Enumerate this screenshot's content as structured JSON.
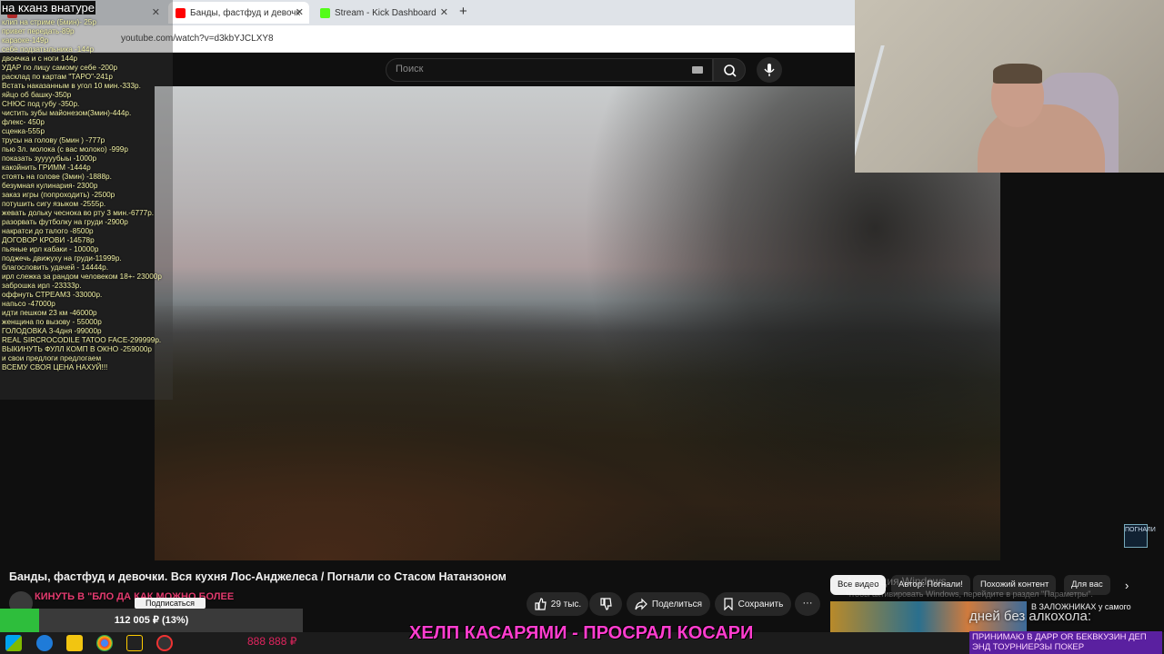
{
  "browser": {
    "tabs": [
      {
        "label": "",
        "favicon_color": "#e22"
      },
      {
        "label": "Банды, фастфуд и девочк",
        "favicon_color": "#ff0000"
      },
      {
        "label": "Stream - Kick Dashboard",
        "favicon_color": "#53fc18"
      }
    ],
    "add_tab_label": "+",
    "close_label": "✕",
    "url": "youtube.com/watch?v=d3kbYJCLXY8"
  },
  "youtube": {
    "search_placeholder": "Поиск",
    "video_title": "Банды, фастфуд и девочки. Вся кухня Лос-Анджелеса / Погнали со Стасом Натанзоном",
    "subscribe_label": "Подписаться",
    "likes_label": "29 тыс.",
    "share_label": "Поделиться",
    "save_label": "Сохранить",
    "more_label": "···",
    "watermark": "ПОГНАЛИ",
    "chips": [
      "Все видео",
      "Автор: Погнали!",
      "Похожий контент",
      "Для вас"
    ],
    "rec_title": "В ЗАЛОЖНИКАХ у самого"
  },
  "overlay": {
    "title": "на кханз внатуре",
    "subscribe_overlay": "КИНУТЬ В \"БЛО ДА КАК МОЖНО БОЛЕЕ",
    "price_list": [
      "клип на стриме (5мин)- 25р",
      "привет передать-89р",
      "караоке-149р",
      "себе подзатыльника -144р",
      "двоечка и с ноги 144р",
      "УДАР по лицу самому себе -200р",
      "расклад по картам \"ТАРО\"-241р",
      "Встать наказанным в угол 10 мин.-333р.",
      "яйцо об башку-350р",
      "СНЮС под губу -350р.",
      "чистить зубы майонезом(3мин)-444р.",
      "флекс- 450р",
      "сценка-555р",
      "трусы на голову (5мин ) -777р",
      "пью 3л. молока (с вас молоко) -999р",
      "показать зууууубыы -1000р",
      "какойнить ГРИММ -1444р",
      "стоять на голове (3мин) -1888р.",
      "безумная кулинария- 2300р",
      "заказ игры (попроходить) -2500р",
      "потушить сигу языком -2555р.",
      "жевать дольку чеснока во рту 3 мин.-6777р.",
      "разорвать футболку на груди -2900р",
      "накратси до талого -8500р",
      "ДОГОВОР КРОВИ -14578р",
      "пьяные ирл кабаки - 10000р",
      "поджечь движуху на груди-11999р.",
      "благословить удачей - 14444р.",
      "ирл слежка за рандом человеком 18+- 23000р",
      "заброшка ирл -23333р.",
      "оффнуть СТРЕАМЗ -33000р.",
      "напьсо -47000р",
      "идти пешком 23 км -46000р",
      "женщина по вызову - 55000р",
      "ГОЛОДОВКА 3-4дня -99000р",
      "REAL SIRCROCODILE TATOO FACE-299999р.",
      "ВЫКИНУТЬ ФУЛЛ КОМП В ОКНО -259000р",
      "и свои предлоги предлогаем",
      "ВСЕМУ СВОЯ ЦЕНА НАХУЙ!!!"
    ],
    "goal_text": "112 005 ₽ (13%)",
    "goal_fraction": 0.13,
    "banner": "ХЕЛП КАСАРЯМИ - ПРОСРАЛ КОСАРИ",
    "banner_right": "ПРИНИМАЮ В ДАРР OR БЕКВКУЗИН ДЕП ЭНД ТОУРНИЕРЗЫ ПОКЕР",
    "right_overlay_text": "дней без алкохола:",
    "taskbar_counter": "888 888 ₽"
  },
  "system": {
    "activation_title": "Активация Windows",
    "activation_sub": "Чтобы активировать Windows, перейдите в раздел \"Параметры\"."
  }
}
